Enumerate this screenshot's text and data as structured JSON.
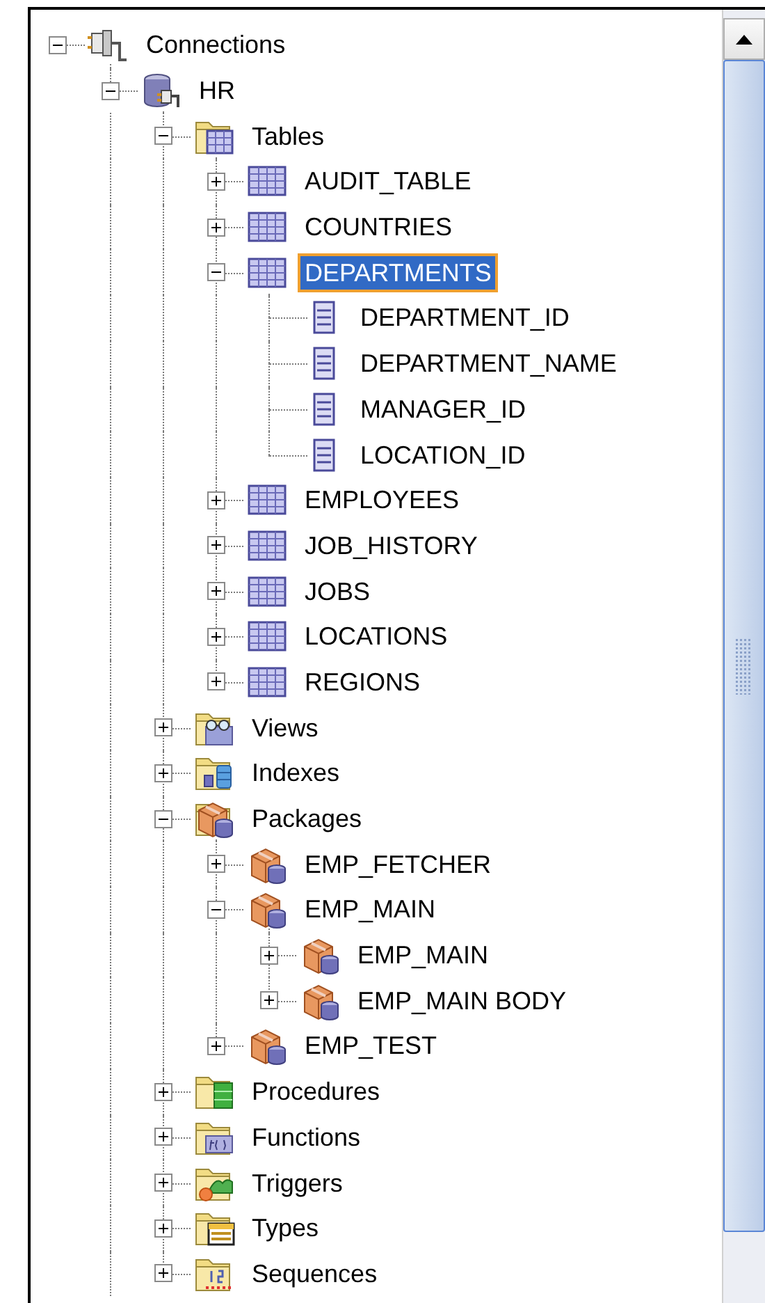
{
  "tree": [
    {
      "label": "Connections",
      "kind": "connection",
      "expanded": true,
      "selected": false,
      "children": [
        {
          "label": "HR",
          "kind": "database",
          "expanded": true,
          "selected": false,
          "children": [
            {
              "label": "Tables",
              "kind": "folder-table",
              "expanded": true,
              "selected": false,
              "children": [
                {
                  "label": "AUDIT_TABLE",
                  "kind": "table",
                  "expanded": false,
                  "selected": false
                },
                {
                  "label": "COUNTRIES",
                  "kind": "table",
                  "expanded": false,
                  "selected": false
                },
                {
                  "label": "DEPARTMENTS",
                  "kind": "table",
                  "expanded": true,
                  "selected": true,
                  "children": [
                    {
                      "label": "DEPARTMENT_ID",
                      "kind": "column",
                      "selected": false
                    },
                    {
                      "label": "DEPARTMENT_NAME",
                      "kind": "column",
                      "selected": false
                    },
                    {
                      "label": "MANAGER_ID",
                      "kind": "column",
                      "selected": false
                    },
                    {
                      "label": "LOCATION_ID",
                      "kind": "column",
                      "selected": false
                    }
                  ]
                },
                {
                  "label": "EMPLOYEES",
                  "kind": "table",
                  "expanded": false,
                  "selected": false
                },
                {
                  "label": "JOB_HISTORY",
                  "kind": "table",
                  "expanded": false,
                  "selected": false
                },
                {
                  "label": "JOBS",
                  "kind": "table",
                  "expanded": false,
                  "selected": false
                },
                {
                  "label": "LOCATIONS",
                  "kind": "table",
                  "expanded": false,
                  "selected": false
                },
                {
                  "label": "REGIONS",
                  "kind": "table",
                  "expanded": false,
                  "selected": false
                }
              ]
            },
            {
              "label": "Views",
              "kind": "folder-view",
              "expanded": false,
              "selected": false
            },
            {
              "label": "Indexes",
              "kind": "folder-index",
              "expanded": false,
              "selected": false
            },
            {
              "label": "Packages",
              "kind": "folder-package",
              "expanded": true,
              "selected": false,
              "children": [
                {
                  "label": "EMP_FETCHER",
                  "kind": "package",
                  "expanded": false,
                  "selected": false
                },
                {
                  "label": "EMP_MAIN",
                  "kind": "package",
                  "expanded": true,
                  "selected": false,
                  "children": [
                    {
                      "label": "EMP_MAIN",
                      "kind": "package",
                      "expanded": false,
                      "selected": false
                    },
                    {
                      "label": "EMP_MAIN BODY",
                      "kind": "package",
                      "expanded": false,
                      "selected": false
                    }
                  ]
                },
                {
                  "label": "EMP_TEST",
                  "kind": "package",
                  "expanded": false,
                  "selected": false
                }
              ]
            },
            {
              "label": "Procedures",
              "kind": "folder-procedure",
              "expanded": false,
              "selected": false
            },
            {
              "label": "Functions",
              "kind": "folder-function",
              "expanded": false,
              "selected": false
            },
            {
              "label": "Triggers",
              "kind": "folder-trigger",
              "expanded": false,
              "selected": false
            },
            {
              "label": "Types",
              "kind": "folder-type",
              "expanded": false,
              "selected": false
            },
            {
              "label": "Sequences",
              "kind": "folder-sequence",
              "expanded": false,
              "selected": false
            }
          ]
        }
      ]
    }
  ]
}
